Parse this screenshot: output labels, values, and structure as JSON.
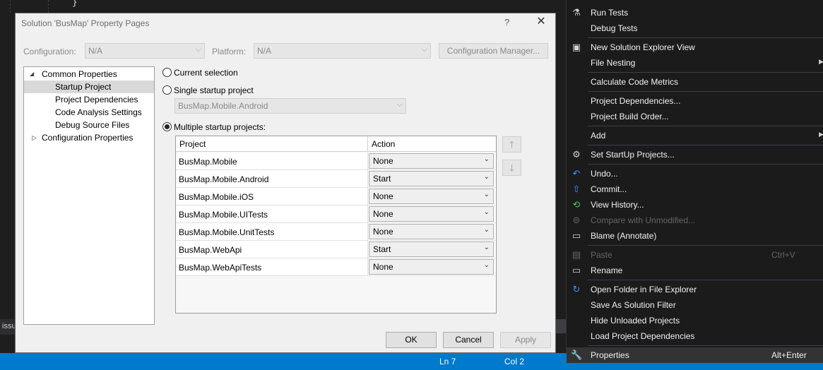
{
  "editor": {
    "closing_brace": "}",
    "output_tab": "issu"
  },
  "statusbar": {
    "line": "Ln 7",
    "col": "Col 2"
  },
  "dialog": {
    "title": "Solution 'BusMap' Property Pages",
    "help": "?",
    "close": "✕",
    "configuration_label": "Configuration:",
    "configuration_value": "N/A",
    "platform_label": "Platform:",
    "platform_value": "N/A",
    "config_manager_label": "Configuration Manager...",
    "tree": {
      "common": "Common Properties",
      "items": [
        "Startup Project",
        "Project Dependencies",
        "Code Analysis Settings",
        "Debug Source Files"
      ],
      "configuration": "Configuration Properties"
    },
    "radio_current": "Current selection",
    "radio_single": "Single startup project",
    "single_value": "BusMap.Mobile.Android",
    "radio_multiple": "Multiple startup projects:",
    "grid": {
      "col_project": "Project",
      "col_action": "Action",
      "rows": [
        {
          "project": "BusMap.Mobile",
          "action": "None"
        },
        {
          "project": "BusMap.Mobile.Android",
          "action": "Start"
        },
        {
          "project": "BusMap.Mobile.iOS",
          "action": "None"
        },
        {
          "project": "BusMap.Mobile.UITests",
          "action": "None"
        },
        {
          "project": "BusMap.Mobile.UnitTests",
          "action": "None"
        },
        {
          "project": "BusMap.WebApi",
          "action": "Start"
        },
        {
          "project": "BusMap.WebApiTests",
          "action": "None"
        }
      ]
    },
    "ok": "OK",
    "cancel": "Cancel",
    "apply": "Apply"
  },
  "context_menu": {
    "run_tests": "Run Tests",
    "debug_tests": "Debug Tests",
    "new_view": "New Solution Explorer View",
    "file_nesting": "File Nesting",
    "calc_metrics": "Calculate Code Metrics",
    "project_deps": "Project Dependencies...",
    "build_order": "Project Build Order...",
    "add": "Add",
    "set_startup": "Set StartUp Projects...",
    "undo": "Undo...",
    "commit": "Commit...",
    "view_history": "View History...",
    "compare": "Compare with Unmodified...",
    "blame": "Blame (Annotate)",
    "paste": "Paste",
    "paste_shortcut": "Ctrl+V",
    "rename": "Rename",
    "open_folder": "Open Folder in File Explorer",
    "save_filter": "Save As Solution Filter",
    "hide_unloaded": "Hide Unloaded Projects",
    "load_deps": "Load Project Dependencies",
    "properties": "Properties",
    "properties_shortcut": "Alt+Enter"
  }
}
